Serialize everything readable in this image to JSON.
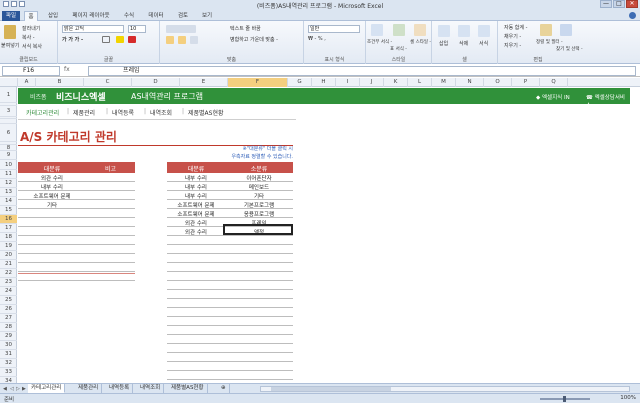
{
  "window": {
    "title": "(비즈폼)AS내역관리 프로그램 - Microsoft Excel",
    "controls": [
      "—",
      "□",
      "✕"
    ]
  },
  "ribbon": {
    "tabs": [
      "파일",
      "홈",
      "삽입",
      "페이지 레이아웃",
      "수식",
      "데이터",
      "검토",
      "보기"
    ],
    "active_tab": "홈",
    "clipboard": {
      "paste": "붙여넣기",
      "cut": "잘라내기",
      "copy": "복사 -",
      "format_painter": "서식 복사",
      "label": "클립보드"
    },
    "font": {
      "name": "맑은 고딕",
      "size": "10",
      "label": "글꼴"
    },
    "alignment": {
      "wrap": "텍스트 줄 바꿈",
      "merge": "병합하고 가운데 맞춤 -",
      "label": "맞춤"
    },
    "number": {
      "format": "일반",
      "label": "표시 형식"
    },
    "styles": {
      "conditional": "조건부 서식 -",
      "table": "표 서식 -",
      "cell": "셀 스타일 -",
      "label": "스타일"
    },
    "cells": {
      "insert": "삽입",
      "delete": "삭제",
      "format": "서식",
      "label": "셀"
    },
    "editing": {
      "autosum": "자동 합계 -",
      "fill": "채우기 -",
      "clear": "지우기 -",
      "sort": "정렬 및 필터 -",
      "find": "찾기 및 선택 -",
      "label": "편집"
    }
  },
  "formula_bar": {
    "cell_ref": "F16",
    "fx": "fx",
    "value": "프레임"
  },
  "columns": [
    "A",
    "B",
    "C",
    "D",
    "E",
    "F",
    "G",
    "H",
    "I",
    "J",
    "K",
    "L",
    "M",
    "N",
    "O",
    "P",
    "Q"
  ],
  "selected_column": "F",
  "rows": [
    "1",
    "2",
    "3",
    "4",
    "5",
    "6",
    "7",
    "8",
    "9",
    "10",
    "11",
    "12",
    "13",
    "14",
    "15",
    "16",
    "17",
    "18",
    "19",
    "20",
    "21",
    "22",
    "23",
    "24",
    "25",
    "26",
    "27",
    "28",
    "29",
    "30",
    "31",
    "32",
    "33",
    "34"
  ],
  "selected_row": "16",
  "banner": {
    "bizform": "비즈폼",
    "brand": "비즈니스엑셀",
    "program": "AS내역관리 프로그램",
    "link_knowledge": "◆ 엑셀지식 IN",
    "link_consult": "☎ 엑셀상담서비스"
  },
  "subnav": [
    "카테고리관리",
    "제품관리",
    "내역등록",
    "내역조회",
    "제품별AS현황"
  ],
  "subnav_active": "카테고리관리",
  "page": {
    "heading": "A/S 카테고리 관리",
    "note_line1": "※\"대분류\" 더블 클릭 시",
    "note_line2": "우측자료 정렬할 수 있습니다."
  },
  "left_table": {
    "headers": [
      "대분류",
      "비고"
    ],
    "rows": [
      "외관 수리",
      "내부 수리",
      "소프트웨어 문제",
      "기타"
    ]
  },
  "right_table": {
    "headers": [
      "대분류",
      "소분류"
    ],
    "rows": [
      [
        "내부 수리",
        "이어폰단자"
      ],
      [
        "내부 수리",
        "메인보드"
      ],
      [
        "내부 수리",
        "기타"
      ],
      [
        "소프트웨어 문제",
        "기본프로그램"
      ],
      [
        "소프트웨어 문제",
        "응용프로그램"
      ],
      [
        "외관 수리",
        "프레임"
      ],
      [
        "외관 수리",
        "액정"
      ]
    ]
  },
  "sheet_tabs": [
    "카테고리관리",
    "제품관리",
    "내역등록",
    "내역조회",
    "제품별AS현황"
  ],
  "active_sheet": "카테고리관리",
  "status": {
    "ready": "준비",
    "zoom": "100%"
  }
}
